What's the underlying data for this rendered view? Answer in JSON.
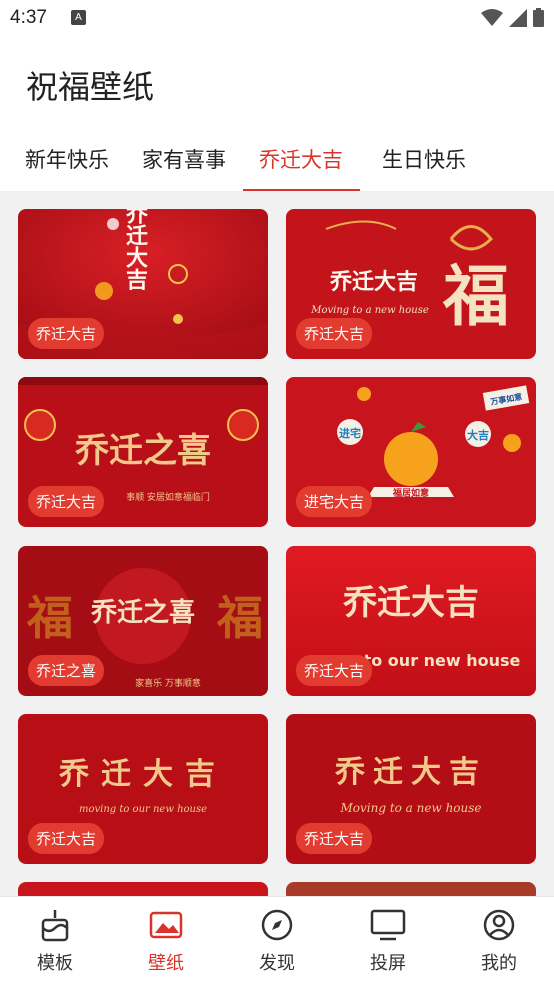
{
  "status": {
    "time": "4:37",
    "notif_letter": "A"
  },
  "header": {
    "title": "祝福壁纸"
  },
  "tabs": [
    {
      "label": "新年快乐",
      "active": false
    },
    {
      "label": "家有喜事",
      "active": false
    },
    {
      "label": "乔迁大吉",
      "active": true
    },
    {
      "label": "生日快乐",
      "active": false
    }
  ],
  "cards": [
    {
      "badge": "乔迁大吉",
      "art_text": "乔迁大吉"
    },
    {
      "badge": "乔迁大吉",
      "art_text": "乔迁大吉",
      "art_fu": "福",
      "art_sub": "Moving to a new house"
    },
    {
      "badge": "乔迁大吉",
      "art_text": "乔迁之喜",
      "art_sub": "事顺   安居如意福临门"
    },
    {
      "badge": "进宅大吉",
      "art_sub": "福居如意",
      "art_tag1": "进宅",
      "art_tag2": "大吉",
      "art_tag3": "万事如意"
    },
    {
      "badge": "乔迁之喜",
      "art_text": "乔迁之喜",
      "art_fu": "福",
      "art_sub": "家喜乐   万事顺意"
    },
    {
      "badge": "乔迁大吉",
      "art_text": "乔迁大吉",
      "art_sub": "to our new house"
    },
    {
      "badge": "乔迁大吉",
      "art_text": "乔迁大吉",
      "art_sub": "moving to our new house"
    },
    {
      "badge": "乔迁大吉",
      "art_text": "乔迁大吉",
      "art_sub": "Moving to a new house"
    }
  ],
  "nav": [
    {
      "label": "模板",
      "icon": "cake-icon",
      "active": false
    },
    {
      "label": "壁纸",
      "icon": "image-icon",
      "active": true
    },
    {
      "label": "发现",
      "icon": "compass-icon",
      "active": false
    },
    {
      "label": "投屏",
      "icon": "tv-icon",
      "active": false
    },
    {
      "label": "我的",
      "icon": "user-icon",
      "active": false
    }
  ]
}
